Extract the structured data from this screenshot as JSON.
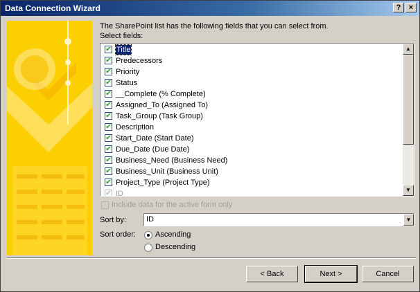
{
  "window": {
    "title": "Data Connection Wizard",
    "help_label": "?",
    "close_label": "×"
  },
  "intro_text": "The SharePoint list has the following fields that you can select from.",
  "select_fields_label": "Select fields:",
  "fields": [
    {
      "label": "Title",
      "checked": true,
      "selected": true
    },
    {
      "label": "Predecessors",
      "checked": true
    },
    {
      "label": "Priority",
      "checked": true
    },
    {
      "label": "Status",
      "checked": true
    },
    {
      "label": "__Complete (% Complete)",
      "checked": true
    },
    {
      "label": "Assigned_To (Assigned To)",
      "checked": true
    },
    {
      "label": "Task_Group (Task Group)",
      "checked": true
    },
    {
      "label": "Description",
      "checked": true
    },
    {
      "label": "Start_Date (Start Date)",
      "checked": true
    },
    {
      "label": "Due_Date (Due Date)",
      "checked": true
    },
    {
      "label": "Business_Need (Business Need)",
      "checked": true
    },
    {
      "label": "Business_Unit (Business Unit)",
      "checked": true
    },
    {
      "label": "Project_Type (Project Type)",
      "checked": true
    },
    {
      "label": "ID",
      "checked": true,
      "disabled": true
    }
  ],
  "include_active_form_label": "Include data for the active form only",
  "sort_by_label": "Sort by:",
  "sort_by_value": "ID",
  "sort_order_label": "Sort order:",
  "sort_order": {
    "ascending_label": "Ascending",
    "descending_label": "Descending",
    "selected": "ascending"
  },
  "buttons": {
    "back_label": "< Back",
    "next_label": "Next >",
    "cancel_label": "Cancel"
  },
  "icons": {
    "checkbox": "✔",
    "scroll_up": "▲",
    "scroll_down": "▼",
    "dropdown": "▼"
  },
  "colors": {
    "art_yellow": "#fcd000",
    "title_blue": "#0a246a",
    "checkmark_green": "#21a121"
  }
}
